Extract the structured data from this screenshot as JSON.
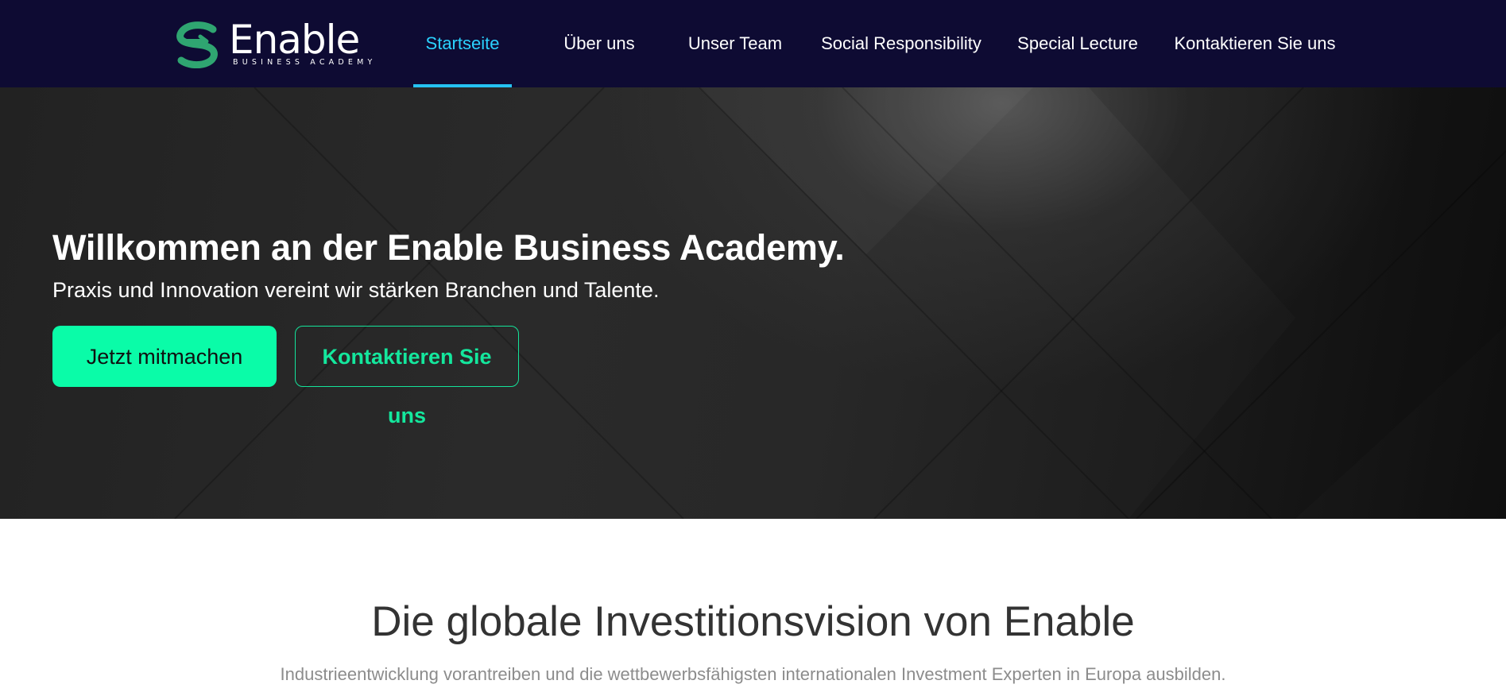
{
  "brand": {
    "name": "Enable",
    "tagline": "BUSINESS ACADEMY",
    "accent_color": "#0afca8",
    "nav_bg_color": "#0e0b33",
    "active_nav_color": "#2bd2ff"
  },
  "nav": {
    "items": [
      {
        "label": "Startseite",
        "active": true
      },
      {
        "label": "Über uns",
        "active": false
      },
      {
        "label": "Unser Team",
        "active": false
      },
      {
        "label": "Social Responsibility",
        "active": false
      },
      {
        "label": "Special Lecture",
        "active": false
      },
      {
        "label": "Kontaktieren Sie uns",
        "active": false
      }
    ]
  },
  "hero": {
    "title": "Willkommen an der Enable Business Academy.",
    "subtitle": "Praxis und Innovation vereint wir stärken Branchen und Talente.",
    "primary_button": "Jetzt mitmachen",
    "secondary_button": "Kontaktieren Sie uns"
  },
  "section": {
    "title": "Die globale Investitionsvision von Enable",
    "subtitle": "Industrieentwicklung vorantreiben und die wettbewerbsfähigsten internationalen Investment Experten in Europa ausbilden."
  }
}
